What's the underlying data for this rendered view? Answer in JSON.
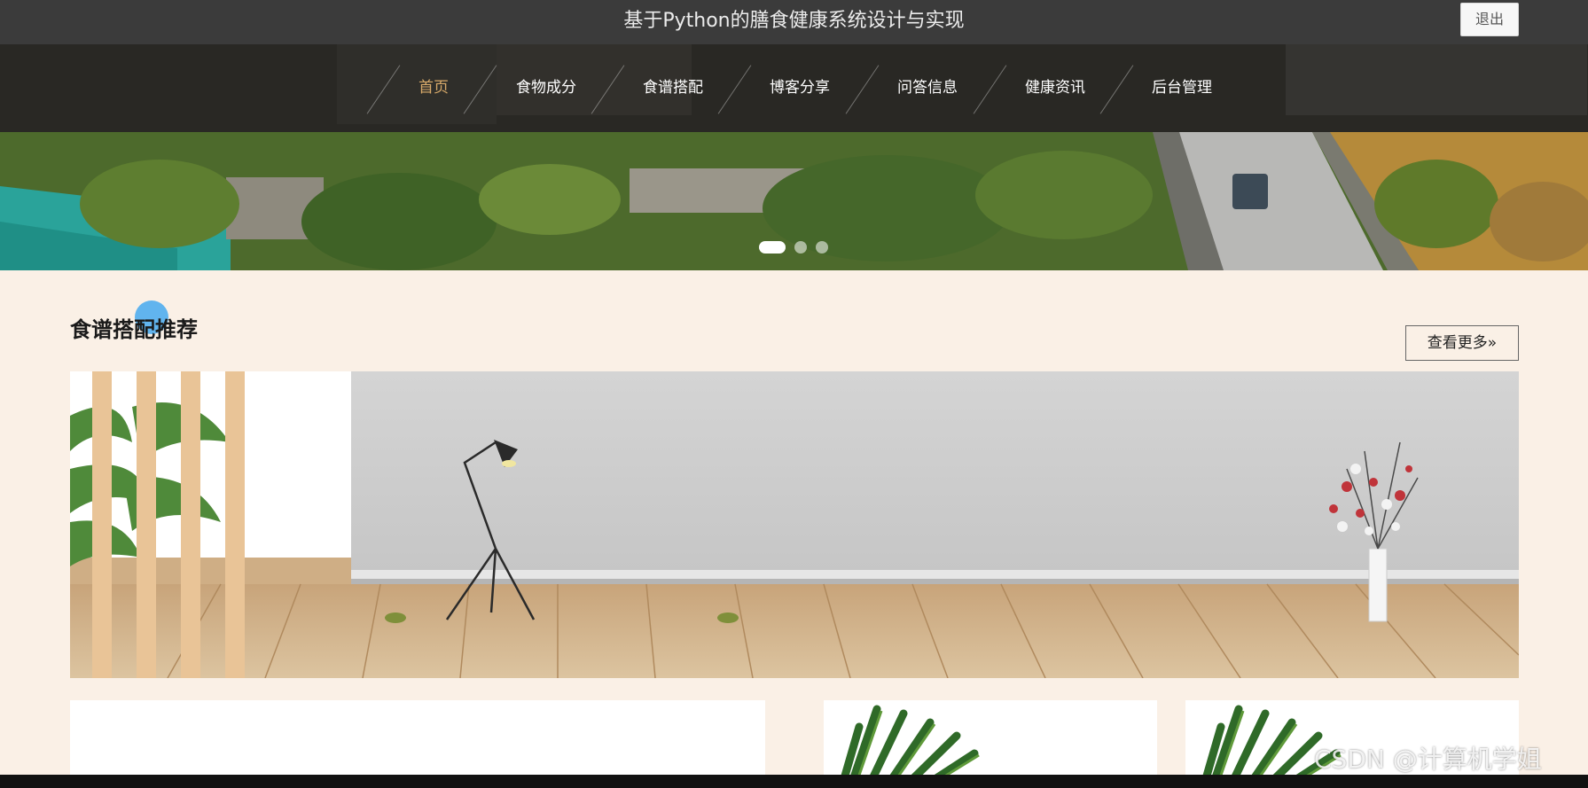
{
  "header": {
    "site_title": "基于Python的膳食健康系统设计与实现",
    "logout_label": "退出"
  },
  "nav": {
    "items": [
      {
        "label": "首页",
        "active": true
      },
      {
        "label": "食物成分",
        "active": false
      },
      {
        "label": "食谱搭配",
        "active": false
      },
      {
        "label": "博客分享",
        "active": false
      },
      {
        "label": "问答信息",
        "active": false
      },
      {
        "label": "健康资讯",
        "active": false
      },
      {
        "label": "后台管理",
        "active": false
      }
    ],
    "active_color": "#d8aa6a"
  },
  "carousel": {
    "slide_count": 3,
    "active_index": 0
  },
  "recommend": {
    "title": "食谱搭配推荐",
    "more_label": "查看更多»"
  },
  "watermark": "CSDN @计算机学姐",
  "colors": {
    "page_bg": "#faf0e6",
    "topbar_bg": "#3b3b3b"
  }
}
